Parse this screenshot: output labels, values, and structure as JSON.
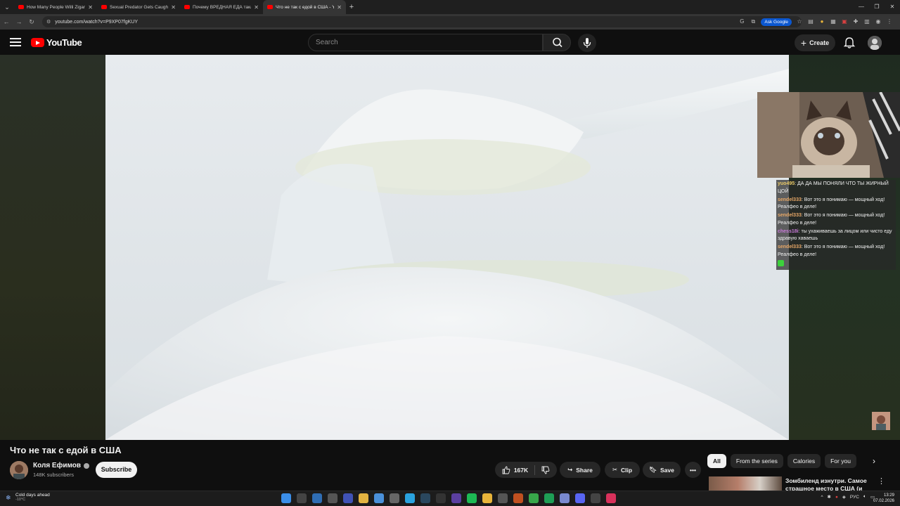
{
  "browser": {
    "tabs": [
      {
        "title": "How Many People Willi Zigan!..."
      },
      {
        "title": "Sexual Predator Gets Caught in..."
      },
      {
        "title": "Почему ВРЕДНАЯ ЕДА такая В..."
      },
      {
        "title": "Что не так с едой в США - You..."
      }
    ],
    "url": "youtube.com/watch?v=P9XP07fgKUY",
    "ask_google": "Ask Google"
  },
  "youtube": {
    "logo": "YouTube",
    "search_placeholder": "Search",
    "create_label": "Create"
  },
  "chat": {
    "messages": [
      {
        "user": "yuo495",
        "color": "#e8c867",
        "text": "ДА ДА МЫ ПОНЯЛИ ЧТО ТЫ ЖИРНЫЙ ЦОЙ"
      },
      {
        "user": "sendel333",
        "color": "#e8a867",
        "text": "Вот это я понимаю — мощный ход! Реалфео в деле!"
      },
      {
        "user": "sendel333",
        "color": "#e8a867",
        "text": "Вот это я понимаю — мощный ход! Реалфео в деле!"
      },
      {
        "user": "chess18i",
        "color": "#c87bd8",
        "text": "ты ухаживаешь за лицом или чисто еду здравую хаваешь"
      },
      {
        "user": "sendel333",
        "color": "#e8a867",
        "text": "Вот это я понимаю — мощный ход! Реалфео в деле!"
      }
    ]
  },
  "video": {
    "title": "Что не так с едой в США",
    "channel": "Коля Ефимов",
    "subscribers": "148K subscribers",
    "subscribe_label": "Subscribe",
    "likes": "167K",
    "share_label": "Share",
    "clip_label": "Clip",
    "save_label": "Save"
  },
  "chips": [
    "All",
    "From the series",
    "Calories",
    "For you"
  ],
  "recommendation": {
    "title": "Зомбиленд изнутри. Самое страшное место в США (и в..."
  },
  "taskbar": {
    "weather_title": "Cold days ahead",
    "weather_temp": "-10°C",
    "lang": "РУС",
    "time": "13:29",
    "date": "07.02.2026"
  },
  "colors": {
    "youtube_red": "#ff0000",
    "chrome_dark": "#1f1f1f",
    "page_bg": "#0f0f0f"
  }
}
